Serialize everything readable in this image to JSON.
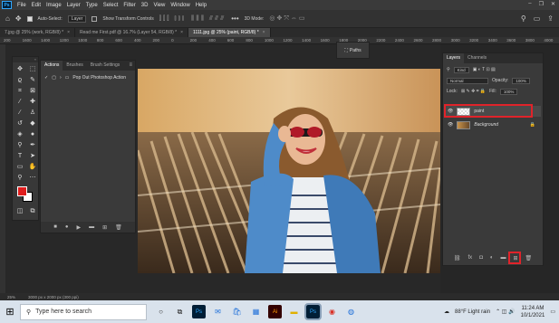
{
  "app": {
    "logo": "Ps",
    "menu": [
      "File",
      "Edit",
      "Image",
      "Layer",
      "Type",
      "Select",
      "Filter",
      "3D",
      "View",
      "Window",
      "Help"
    ]
  },
  "options_bar": {
    "auto_select_label": "Auto-Select:",
    "auto_select_value": "Layer",
    "show_transform_label": "Show Transform Controls",
    "mode_label": "3D Mode:"
  },
  "tabs": [
    {
      "label": "7.jpg @ 25% (work, RGB/8) *"
    },
    {
      "label": "Read me First.pdf @ 16.7% (Layer 54, RGB/8) *"
    },
    {
      "label": "1111.jpg @ 25% (paint, RGB/8) *"
    }
  ],
  "ruler": [
    "200",
    "1600",
    "1400",
    "1200",
    "1000",
    "800",
    "600",
    "400",
    "200",
    "0",
    "200",
    "400",
    "600",
    "800",
    "1000",
    "1200",
    "1400",
    "1600",
    "1800",
    "2000",
    "2200",
    "2400",
    "2600",
    "2800",
    "3000",
    "3200",
    "3400",
    "3600",
    "3800",
    "4000"
  ],
  "paths_panel": {
    "label": "Paths"
  },
  "actions_panel": {
    "tabs": [
      "Actions",
      "Brushes",
      "Brush Settings"
    ],
    "item": "Pop Out Photoshop Action"
  },
  "layers_panel": {
    "tabs": [
      "Layers",
      "Channels"
    ],
    "kind": "Kind",
    "blend_mode": "Normal",
    "opacity_label": "Opacity:",
    "opacity_value": "100%",
    "lock_label": "Lock:",
    "fill_label": "Fill:",
    "fill_value": "100%",
    "layers": [
      {
        "name": "paint",
        "selected": true
      },
      {
        "name": "Background",
        "selected": false
      }
    ]
  },
  "status": {
    "zoom": "25%",
    "doc": "3000 px x 2000 px (300 ppi)"
  },
  "taskbar": {
    "search_placeholder": "Type here to search",
    "weather": "88°F  Light rain",
    "time": "11:24 AM",
    "date": "10/1/2021"
  },
  "colors": {
    "foreground": "#e01e1e",
    "background": "#ffffff",
    "highlight": "#e0232a"
  }
}
